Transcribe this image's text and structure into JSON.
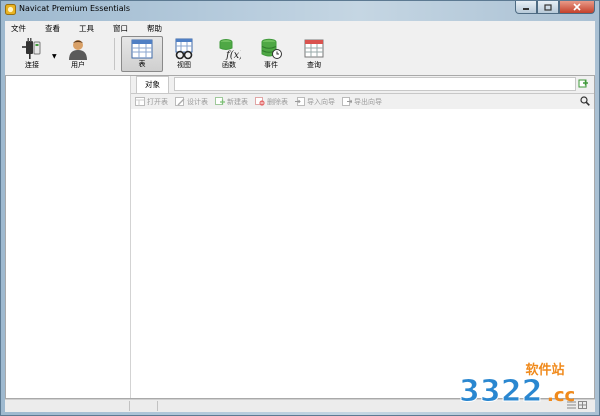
{
  "window": {
    "title": "Navicat Premium Essentials"
  },
  "menu": [
    "文件",
    "查看",
    "工具",
    "窗口",
    "帮助"
  ],
  "toolbar": {
    "connect": "连接",
    "user": "用户",
    "table": "表",
    "view": "视图",
    "function": "函数",
    "event": "事件",
    "query": "查询"
  },
  "tabs": {
    "objects": "对象"
  },
  "object_toolbar": {
    "open_table": "打开表",
    "design_table": "设计表",
    "new_table": "新建表",
    "delete_table": "删除表",
    "import_wizard": "导入向导",
    "export_wizard": "导出向导"
  },
  "watermark": {
    "brand": "软件站",
    "domain_left": "3322",
    "domain_right": ".cc"
  },
  "colors": {
    "accent_green": "#3f9a3a",
    "watermark_orange": "#f08a1c",
    "watermark_blue": "#2a87d0"
  }
}
